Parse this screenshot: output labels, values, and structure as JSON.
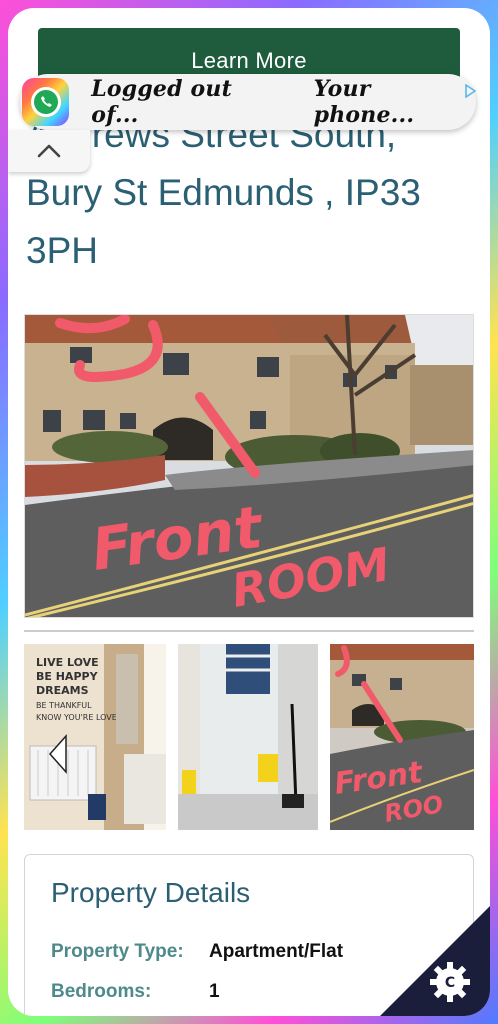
{
  "cta": {
    "label": "Learn More"
  },
  "listing": {
    "title": "Andrews Street South, Bury St Edmunds , IP33 3PH"
  },
  "notification": {
    "items": [
      "Logged out of...",
      "Your phone..."
    ]
  },
  "photos": {
    "main_annotation": [
      "Front",
      "ROOM"
    ],
    "thumb_annotation": [
      "Front",
      "ROO"
    ]
  },
  "details": {
    "heading": "Property Details",
    "rows": [
      {
        "label": "Property Type:",
        "value": "Apartment/Flat"
      },
      {
        "label": "Bedrooms:",
        "value": "1"
      }
    ]
  },
  "corner_badge": {
    "letter": "C"
  },
  "colors": {
    "cta_bg": "#1f5c3d",
    "title": "#2b5f73",
    "label": "#4f8a8b",
    "annotation": "#f05a6a"
  },
  "icons": {
    "notification_app": "whatsapp-icon",
    "collapse": "chevron-up-icon",
    "gallery_prev": "chevron-left-icon",
    "corner": "gear-icon"
  }
}
